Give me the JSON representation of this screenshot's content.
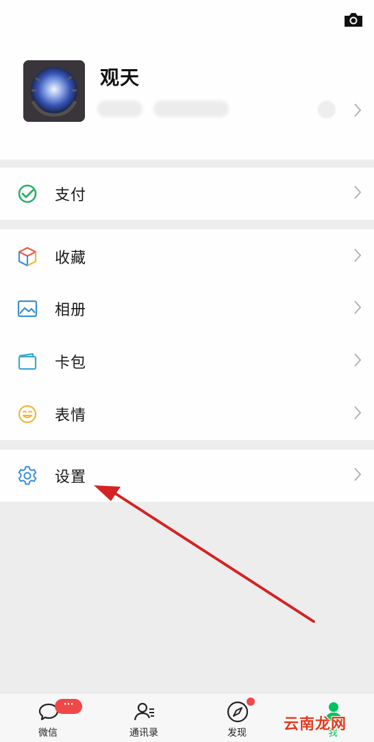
{
  "profile": {
    "nickname": "观天",
    "avatar_icon": "fisheye-photo-avatar",
    "camera_icon": "camera-icon"
  },
  "menu": {
    "pay": {
      "label": "支付",
      "icon": "wallet-check-icon"
    },
    "favorites": {
      "label": "收藏",
      "icon": "cube-icon"
    },
    "album": {
      "label": "相册",
      "icon": "picture-icon"
    },
    "cards": {
      "label": "卡包",
      "icon": "card-icon"
    },
    "stickers": {
      "label": "表情",
      "icon": "smile-icon"
    },
    "settings": {
      "label": "设置",
      "icon": "gear-icon"
    }
  },
  "tabbar": {
    "chats": {
      "label": "微信",
      "badge": "···"
    },
    "contacts": {
      "label": "通讯录"
    },
    "discover": {
      "label": "发现"
    },
    "me": {
      "label": "我"
    }
  },
  "watermark": "云南龙网",
  "colors": {
    "brand_green": "#07c160",
    "badge_red": "#f04848",
    "annotation_arrow": "#d42323"
  }
}
